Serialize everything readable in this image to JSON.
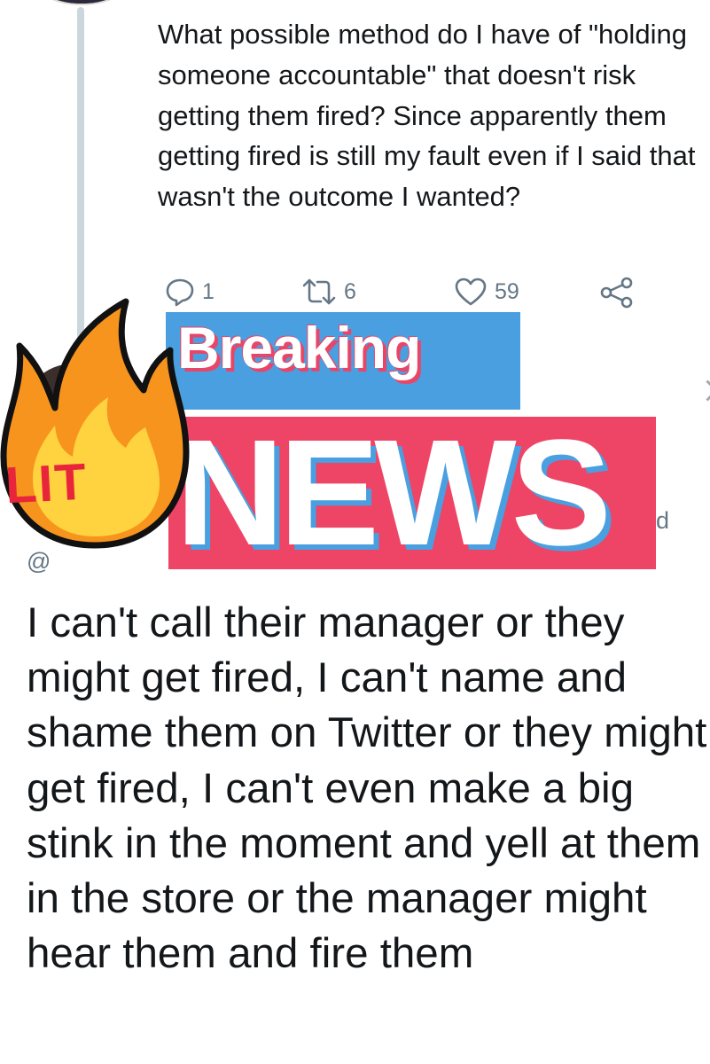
{
  "tweet_parent": {
    "text": "What possible method do I have of \"holding someone accountable\" that doesn't risk getting them fired? Since apparently them getting fired is still my fault even if I said that wasn't the outcome I wanted?",
    "reply_count": "1",
    "retweet_count": "6",
    "like_count": "59"
  },
  "overlay": {
    "breaking": "Breaking",
    "news": "NEWS",
    "lit": "LIT"
  },
  "tweet_reply": {
    "handle_partial": "@",
    "right_fragment": "d",
    "text": "I can't call their manager or they might get fired, I can't name and shame them on Twitter or they might get fired, I can't even make a big stink in the moment and yell at them in the store or the manager might hear them and fire them"
  },
  "colors": {
    "text": "#14171a",
    "muted": "#657786",
    "thread_line": "#ccd6dd",
    "breaking_blue": "#4a9fe0",
    "news_pink": "#ee4466",
    "flame_orange": "#f7941d",
    "flame_yellow": "#ffd23f"
  },
  "icons": [
    "reply-icon",
    "retweet-icon",
    "like-icon",
    "share-icon",
    "flame-icon"
  ]
}
